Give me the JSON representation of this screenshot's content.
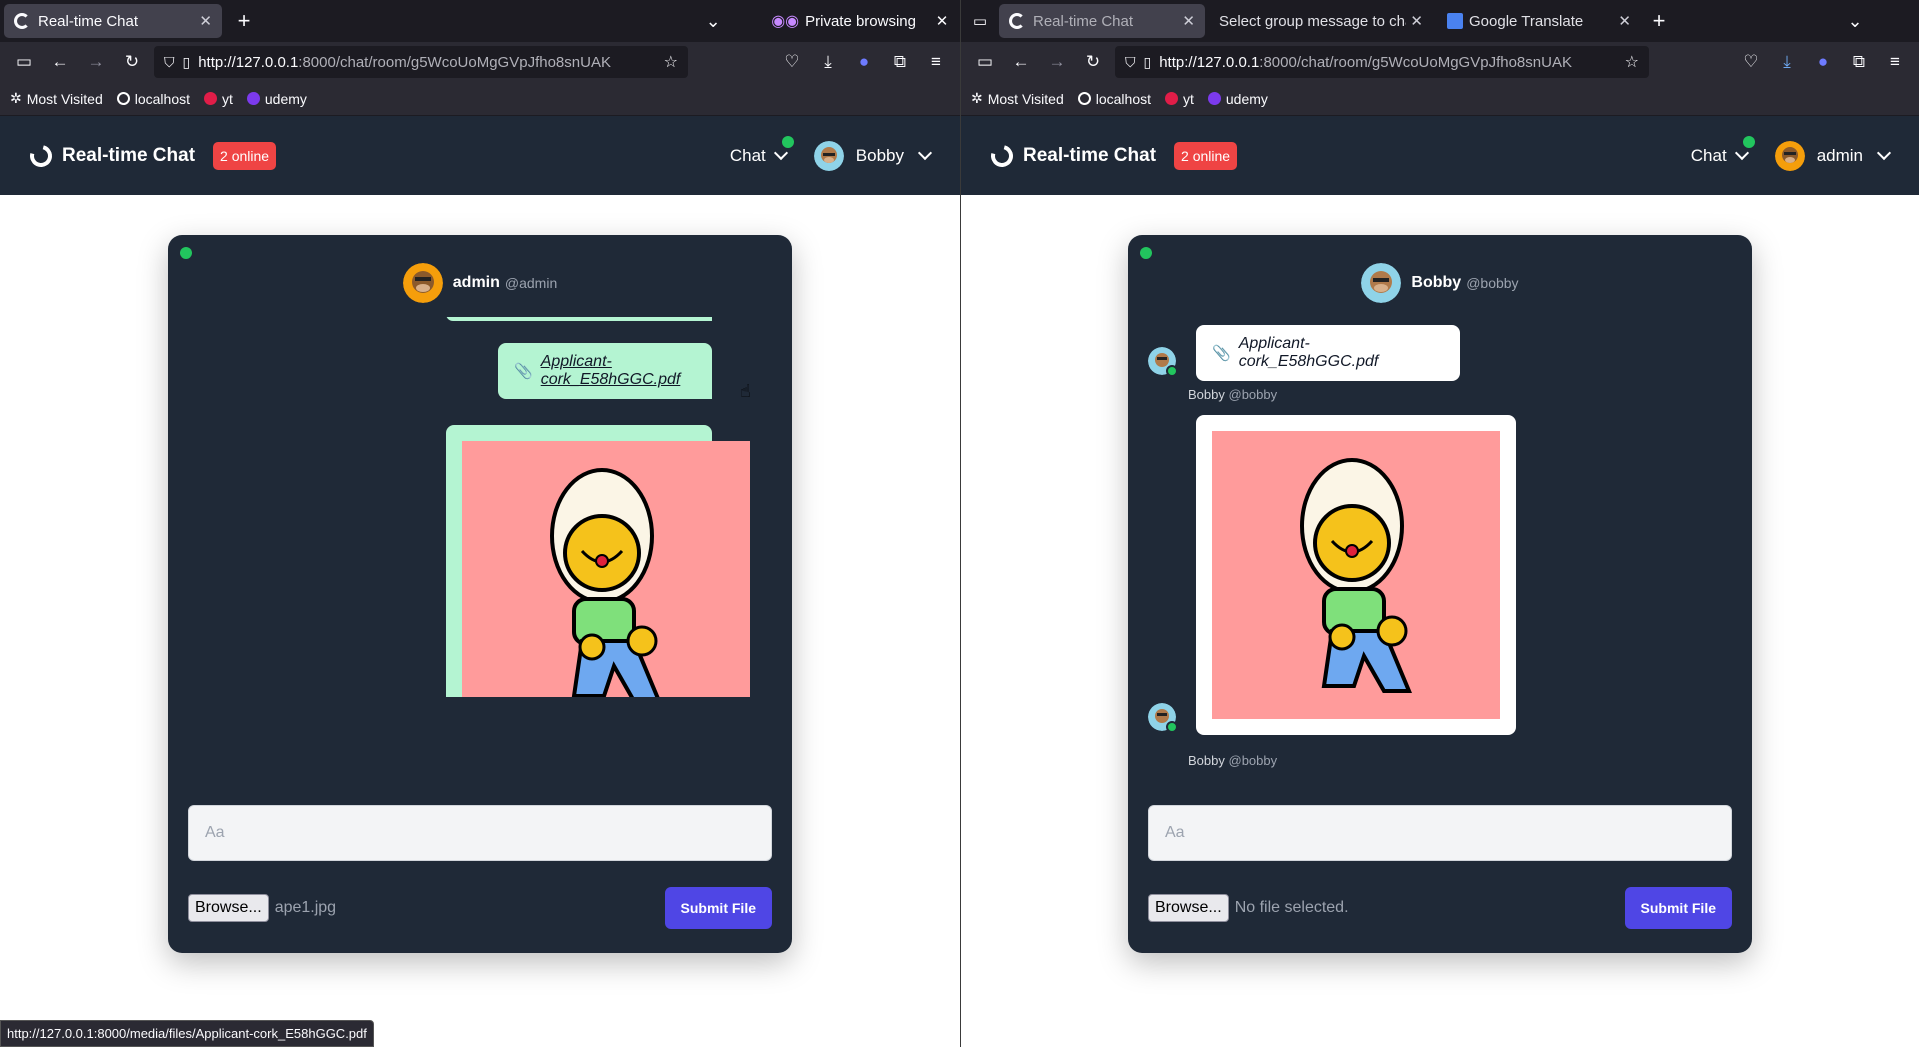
{
  "left": {
    "tabs": [
      {
        "title": "Real-time Chat",
        "active": true
      }
    ],
    "private_label": "Private browsing",
    "url_host": "http://127.0.0.1",
    "url_rest": ":8000/chat/room/g5WcoUoMgGVpJfho8snUAK",
    "bookmarks": [
      "Most Visited",
      "localhost",
      "yt",
      "udemy"
    ],
    "app": {
      "brand": "Real-time Chat",
      "online": "2 online",
      "chat_menu": "Chat",
      "user": "Bobby"
    },
    "card": {
      "partner_name": "admin",
      "partner_handle": "@admin",
      "file_message": "Applicant-cork_E58hGGC.pdf",
      "input_placeholder": "Aa",
      "browse_label": "Browse...",
      "file_selected": "ape1.jpg",
      "submit_label": "Submit File"
    },
    "status_url": "http://127.0.0.1:8000/media/files/Applicant-cork_E58hGGC.pdf"
  },
  "right": {
    "tabs": [
      {
        "title": "Real-time Chat",
        "active": true
      },
      {
        "title": "Select group message to cha",
        "active": false
      },
      {
        "title": "Google Translate",
        "active": false
      }
    ],
    "url_host": "http://127.0.0.1",
    "url_rest": ":8000/chat/room/g5WcoUoMgGVpJfho8snUAK",
    "bookmarks": [
      "Most Visited",
      "localhost",
      "yt",
      "udemy"
    ],
    "app": {
      "brand": "Real-time Chat",
      "online": "2 online",
      "chat_menu": "Chat",
      "user": "admin"
    },
    "card": {
      "partner_name": "Bobby",
      "partner_handle": "@bobby",
      "file_message": "Applicant-cork_E58hGGC.pdf",
      "meta_name": "Bobby",
      "meta_handle": "@bobby",
      "input_placeholder": "Aa",
      "browse_label": "Browse...",
      "file_selected": "No file selected.",
      "submit_label": "Submit File"
    }
  },
  "colors": {
    "tabbar": "#1c1b22",
    "navbar": "#2b2a33",
    "appbar": "#1f2937",
    "card": "#1f2937",
    "mine_bubble": "#b4f4d2",
    "online_badge": "#ef4444",
    "online_dot": "#22c55e",
    "submit": "#4f46e5",
    "image_bg": "#ff9b9b"
  },
  "icons": [
    "sidebar-icon",
    "back-icon",
    "forward-icon",
    "reload-icon",
    "shield-icon",
    "page-icon",
    "star-icon",
    "pocket-icon",
    "download-icon",
    "extension-icon",
    "menu-icon",
    "paperclip-icon",
    "plus-icon",
    "chevron-down-icon",
    "close-icon",
    "mask-icon"
  ]
}
